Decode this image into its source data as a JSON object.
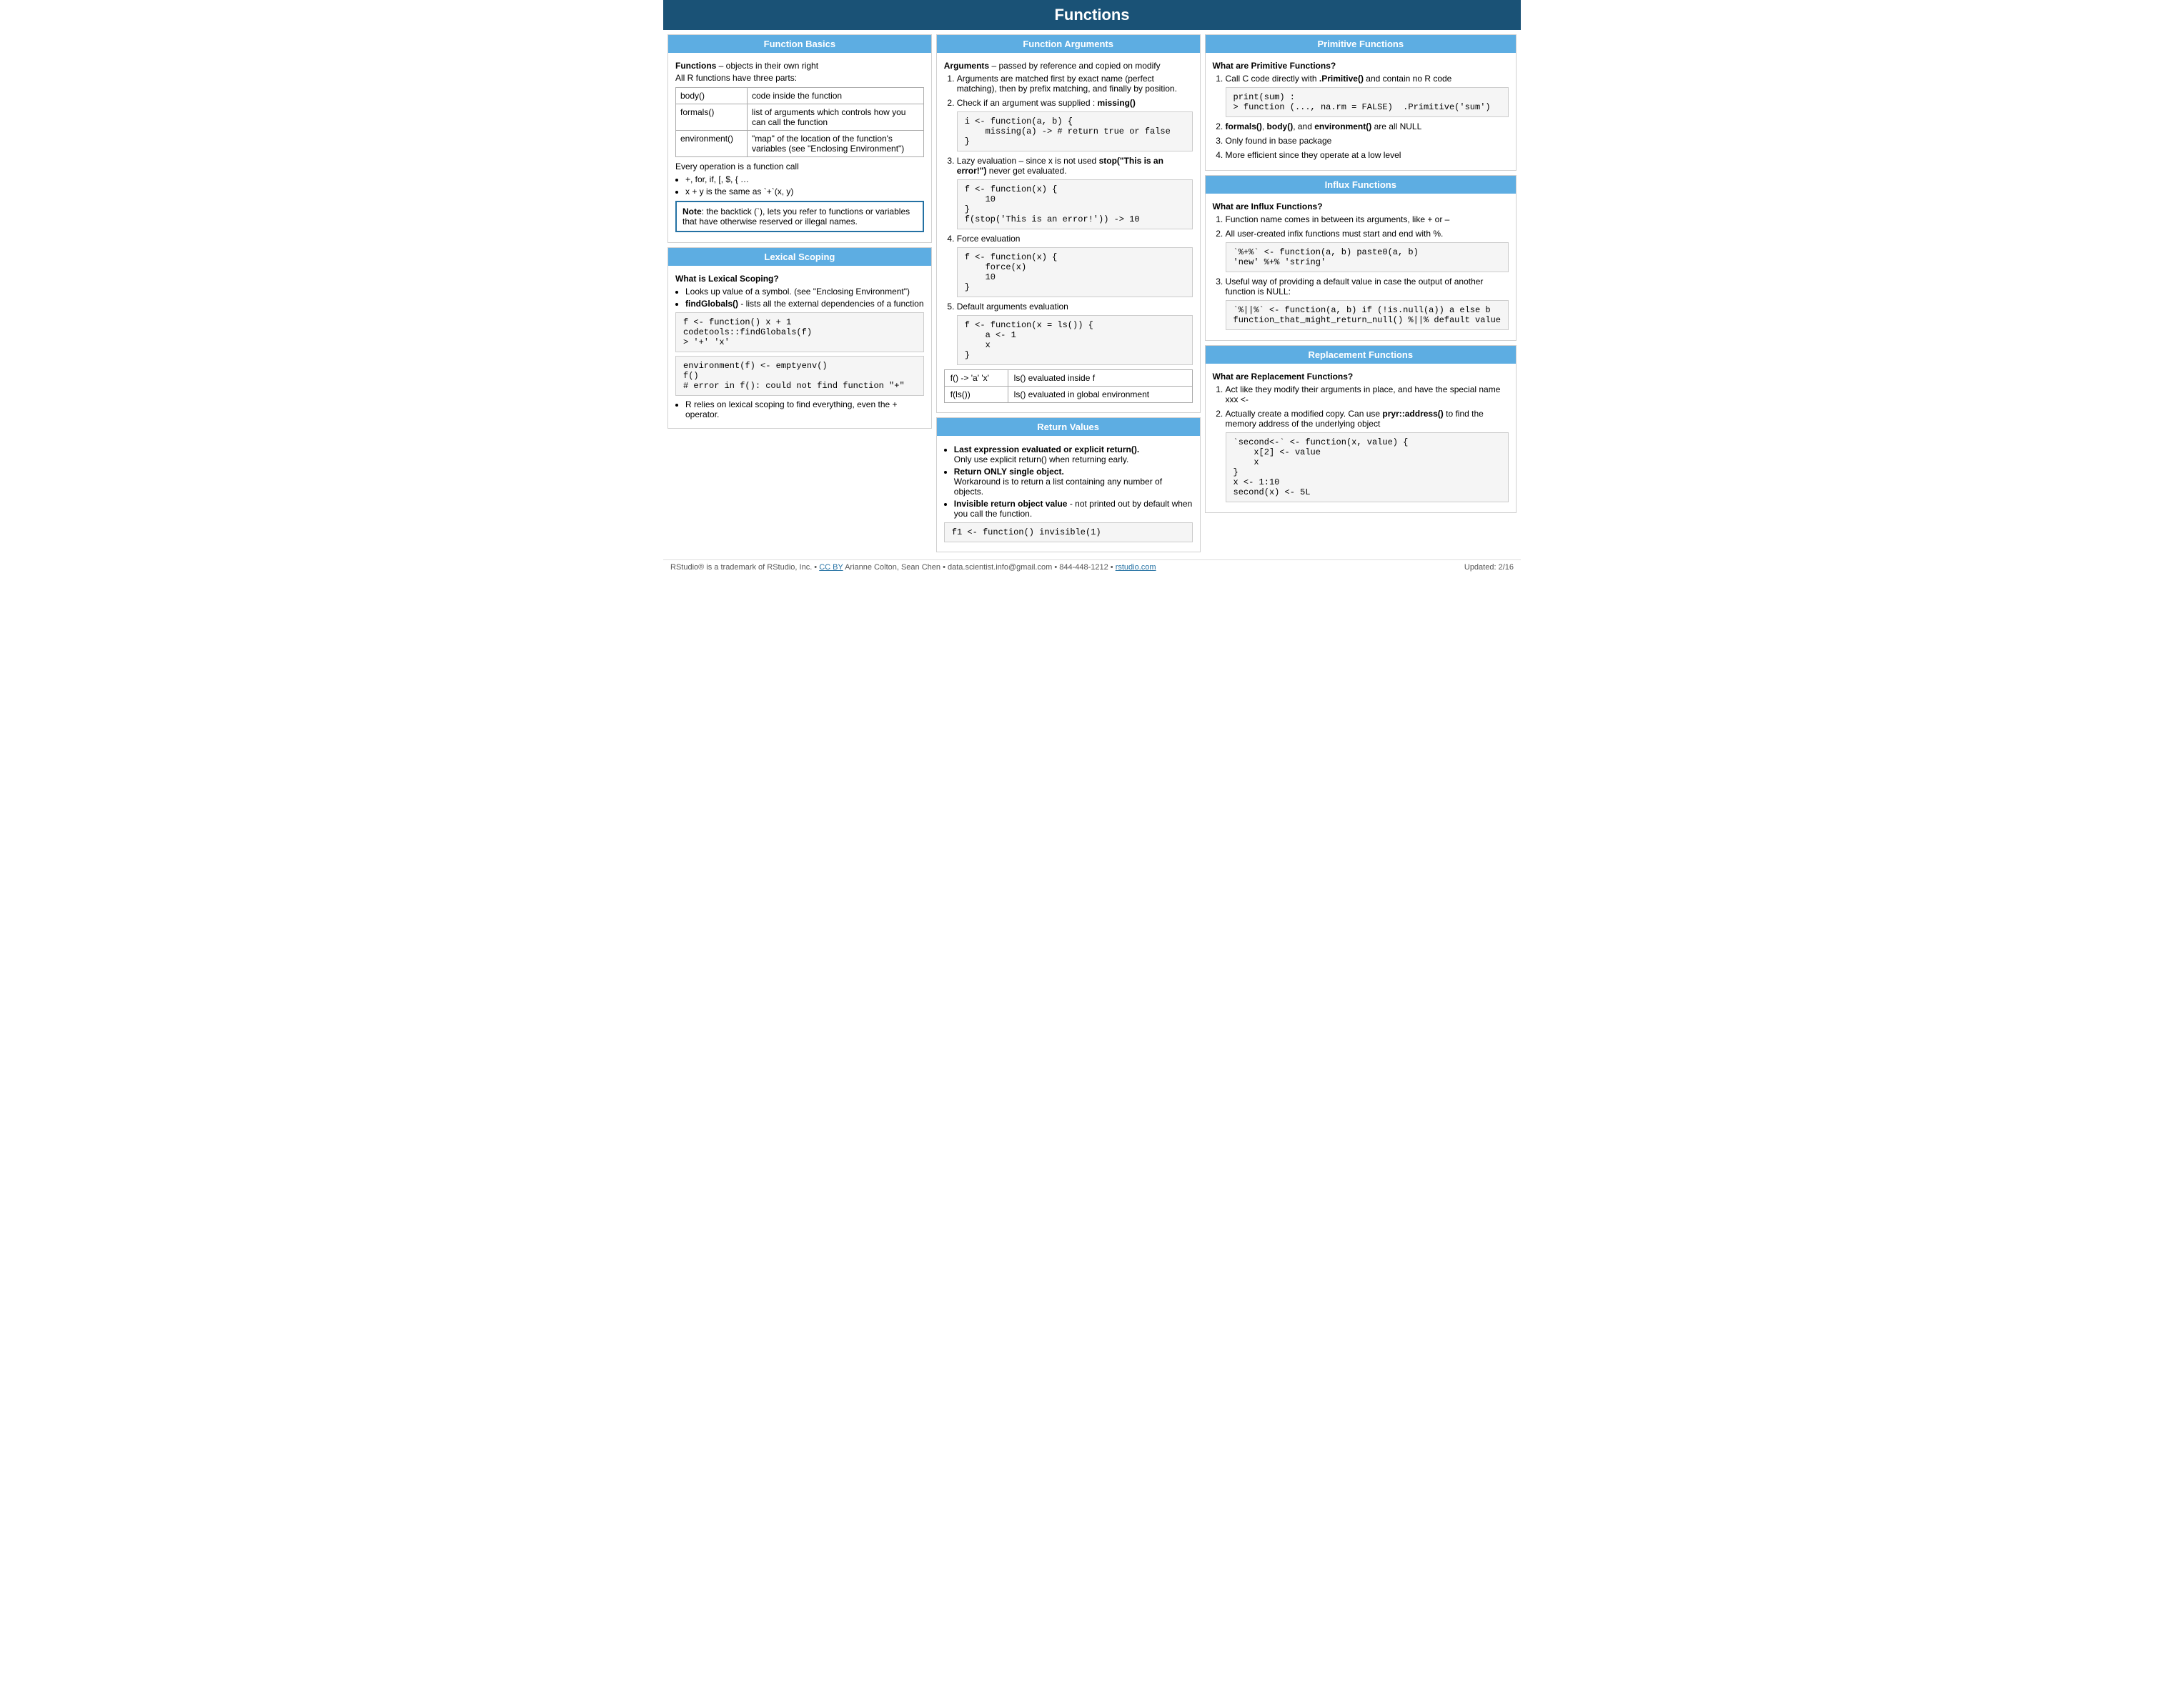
{
  "title": "Functions",
  "col1": {
    "section1_header": "Function Basics",
    "intro1": "Functions – objects in their own right",
    "intro2": "All R functions have three parts:",
    "func_table": [
      {
        "name": "body()",
        "desc": "code inside the function"
      },
      {
        "name": "formals()",
        "desc": "list of arguments which controls how you can call the function"
      },
      {
        "name": "environment()",
        "desc": "\"map\" of the location of the function's variables (see \"Enclosing Environment\")"
      }
    ],
    "every_op": "Every operation is a function call",
    "bullets1": [
      "+, for, if, [, $, { ...",
      "x + y is the same as `+`(x, y)"
    ],
    "note_label": "Note",
    "note_text": ": the backtick (`), lets you refer to functions or variables that have otherwise reserved or illegal names.",
    "section2_header": "Lexical Scoping",
    "lex_header": "What is Lexical Scoping?",
    "lex_bullets": [
      "Looks up value of a symbol. (see \"Enclosing Environment\")",
      "findGlobals() - lists all the external dependencies of a function"
    ],
    "lex_bold2_pre": "",
    "lex_code1": "f <- function() x + 1\ncodetools::findGlobals(f)\n> '+' 'x'",
    "lex_code2": "environment(f) <- emptyenv()\nf()\n# error in f(): could not find function \"+\"",
    "lex_footer": "R relies on lexical scoping to find everything, even the + operator."
  },
  "col2": {
    "section1_header": "Function Arguments",
    "args_intro_bold": "Arguments",
    "args_intro_rest": " – passed by reference and copied on modify",
    "args_list": [
      {
        "text": "Arguments are matched first by exact name (perfect matching), then by prefix matching, and finally by position.",
        "code": null
      },
      {
        "text": "Check if an argument was supplied :  missing()",
        "bold": "missing()",
        "code": "i <- function(a, b) {\n    missing(a) -> # return true or false\n}"
      },
      {
        "text_pre": "Lazy evaluation – since x is not used ",
        "text_bold": "stop(\"This is an error!\")",
        "text_post": " never get evaluated.",
        "code": "f <- function(x) {\n    10\n}\nf(stop('This is an error!')) -> 10"
      },
      {
        "text": "Force evaluation",
        "code": "f <- function(x) {\n    force(x)\n    10\n}"
      },
      {
        "text": "Default arguments evaluation",
        "code": "f <- function(x = ls()) {\n    a <- 1\n    x\n}"
      }
    ],
    "args_table": [
      [
        "f() -> 'a' 'x'",
        "ls() evaluated inside f"
      ],
      [
        "f(ls())",
        "ls() evaluated in global environment"
      ]
    ],
    "section2_header": "Return Values",
    "rv_bullets": [
      {
        "bold": "Last expression evaluated or explicit return().",
        "rest": "\nOnly use explicit return() when returning early."
      },
      {
        "bold": "Return ONLY single object.",
        "rest": "\nWorkaround is to return a list containing any number of objects."
      },
      {
        "bold": "Invisible return object value",
        "rest": " - not printed out by default  when you call the function."
      }
    ],
    "rv_code": "f1 <- function() invisible(1)"
  },
  "col3": {
    "section1_header": "Primitive Functions",
    "prim_header": "What are Primitive Functions?",
    "prim_list": [
      {
        "pre": "Call C code directly with ",
        "bold": ".Primitive()",
        "post": " and contain no R code"
      },
      {
        "text": "",
        "code": "print(sum) :\n> function (..., na.rm = FALSE)  .Primitive('sum')"
      },
      {
        "text": "formals(), body(), and environment() are all NULL",
        "bold_parts": [
          "formals()",
          "body()",
          "environment()"
        ]
      },
      {
        "text": "Only found in base package"
      },
      {
        "text": "More efficient since they operate at a low level"
      }
    ],
    "section2_header": "Influx Functions",
    "influx_header": "What are Influx Functions?",
    "influx_list": [
      {
        "text": "Function name comes in between its arguments, like + or –"
      },
      {
        "text": "All user-created infix functions must start and end with %."
      },
      {
        "code": "`%+%` <- function(a, b) paste0(a, b)\n'new' %+% 'string'"
      },
      {
        "pre": "Useful way of providing a default value in case the output of another function is NULL:",
        "code": "`%||%` <- function(a, b) if (!is.null(a)) a else b\nfunction_that_might_return_null() %||% default value"
      }
    ],
    "section3_header": "Replacement Functions",
    "replace_header": "What are Replacement Functions?",
    "replace_list": [
      {
        "pre": "Act like they modify their arguments in place, and have the special name xxx <-"
      },
      {
        "pre": "Actually create a modified copy. Can use ",
        "bold": "pryr::address()",
        "post": " to find the memory address of the underlying object"
      },
      {
        "code": "`second<-` <- function(x, value) {\n    x[2] <- value\n    x\n}\nx <- 1:10\nsecond(x) <- 5L"
      }
    ]
  },
  "footer": {
    "left": "RStudio® is a trademark of RStudio, Inc.  •  CC BY  Arianne Colton, Sean Chen  •  data.scientist.info@gmail.com  •  844-448-1212  •  rstudio.com",
    "right": "Updated: 2/16"
  }
}
